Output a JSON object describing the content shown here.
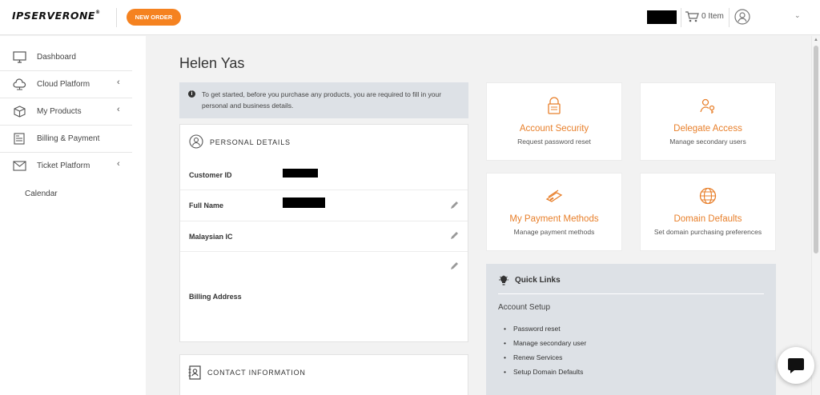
{
  "header": {
    "logo_text": "IPSERVERONE",
    "logo_mark": "®",
    "new_order_label": "NEW ORDER",
    "cart_label": "0 Item"
  },
  "sidebar": {
    "items": [
      {
        "label": "Dashboard",
        "icon": "monitor-icon",
        "has_submenu": false
      },
      {
        "label": "Cloud Platform",
        "icon": "cloud-icon",
        "has_submenu": true
      },
      {
        "label": "My Products",
        "icon": "box-icon",
        "has_submenu": true
      },
      {
        "label": "Billing & Payment",
        "icon": "invoice-icon",
        "has_submenu": false
      },
      {
        "label": "Ticket Platform",
        "icon": "envelope-icon",
        "has_submenu": true
      }
    ],
    "sub_item": "Calendar"
  },
  "main": {
    "page_title": "Helen Yas",
    "notice": "To get started, before you purchase any products, you are required to fill in your personal and business details.",
    "personal": {
      "title": "PERSONAL DETAILS",
      "rows": [
        {
          "label": "Customer ID",
          "editable": false
        },
        {
          "label": "Full Name",
          "editable": true
        },
        {
          "label": "Malaysian IC",
          "editable": true
        },
        {
          "label": "Billing Address",
          "editable": true
        }
      ]
    },
    "contact": {
      "title": "CONTACT INFORMATION"
    },
    "tiles": [
      {
        "title": "Account Security",
        "subtitle": "Request password reset",
        "icon": "lock-icon"
      },
      {
        "title": "Delegate Access",
        "subtitle": "Manage secondary users",
        "icon": "user-key-icon"
      },
      {
        "title": "My Payment Methods",
        "subtitle": "Manage payment methods",
        "icon": "credit-card-icon"
      },
      {
        "title": "Domain Defaults",
        "subtitle": "Set domain purchasing preferences",
        "icon": "globe-www-icon"
      }
    ],
    "quick_links": {
      "title": "Quick Links",
      "section": "Account Setup",
      "links": [
        "Password reset",
        "Manage secondary user",
        "Renew Services",
        "Setup Domain Defaults"
      ]
    }
  },
  "colors": {
    "accent": "#f58220",
    "tile_title": "#e8802c",
    "panel_gray": "#dde1e6",
    "background": "#f2f2f2"
  }
}
